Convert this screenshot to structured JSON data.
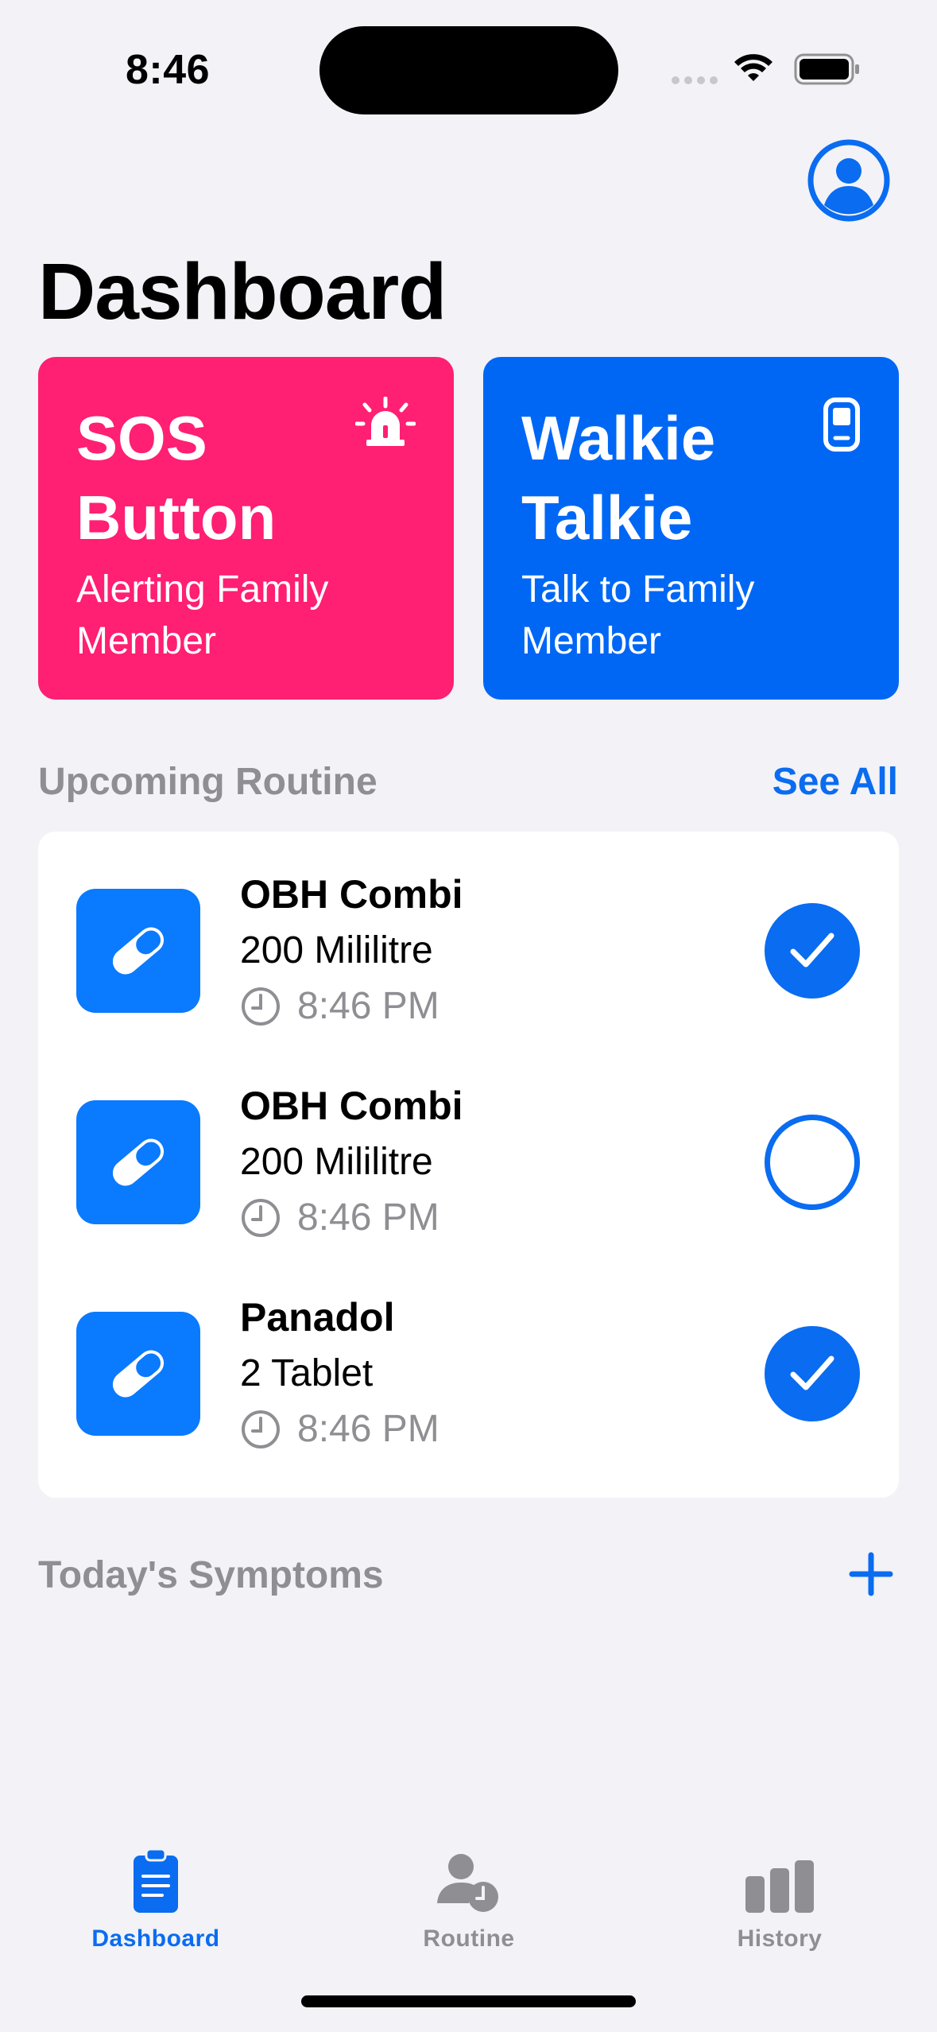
{
  "status_bar": {
    "time": "8:46"
  },
  "header": {
    "title": "Dashboard",
    "profile_icon": "person-circle-icon"
  },
  "cards": {
    "sos": {
      "title": "SOS Button",
      "subtitle": "Alerting Family Member",
      "icon": "siren-icon",
      "color": "#FF1F73"
    },
    "walkie": {
      "title": "Walkie Talkie",
      "subtitle": "Talk to Family Member",
      "icon": "walkie-talkie-icon",
      "color": "#0067F5"
    }
  },
  "routine": {
    "title": "Upcoming Routine",
    "see_all": "See All",
    "items": [
      {
        "name": "OBH Combi",
        "dose": "200 Mililitre",
        "time": "8:46 PM",
        "done": true
      },
      {
        "name": "OBH Combi",
        "dose": "200 Mililitre",
        "time": "8:46 PM",
        "done": false
      },
      {
        "name": "Panadol",
        "dose": "2 Tablet",
        "time": "8:46 PM",
        "done": true
      }
    ]
  },
  "symptoms": {
    "title": "Today's Symptoms",
    "add_icon": "plus-icon"
  },
  "tabbar": {
    "tabs": [
      {
        "label": "Dashboard",
        "icon": "clipboard-icon",
        "active": true
      },
      {
        "label": "Routine",
        "icon": "person-clock-icon",
        "active": false
      },
      {
        "label": "History",
        "icon": "bar-chart-icon",
        "active": false
      }
    ]
  },
  "colors": {
    "accent": "#0A6CF0",
    "background": "#F2F2F7",
    "secondary_text": "#8E8E93"
  }
}
